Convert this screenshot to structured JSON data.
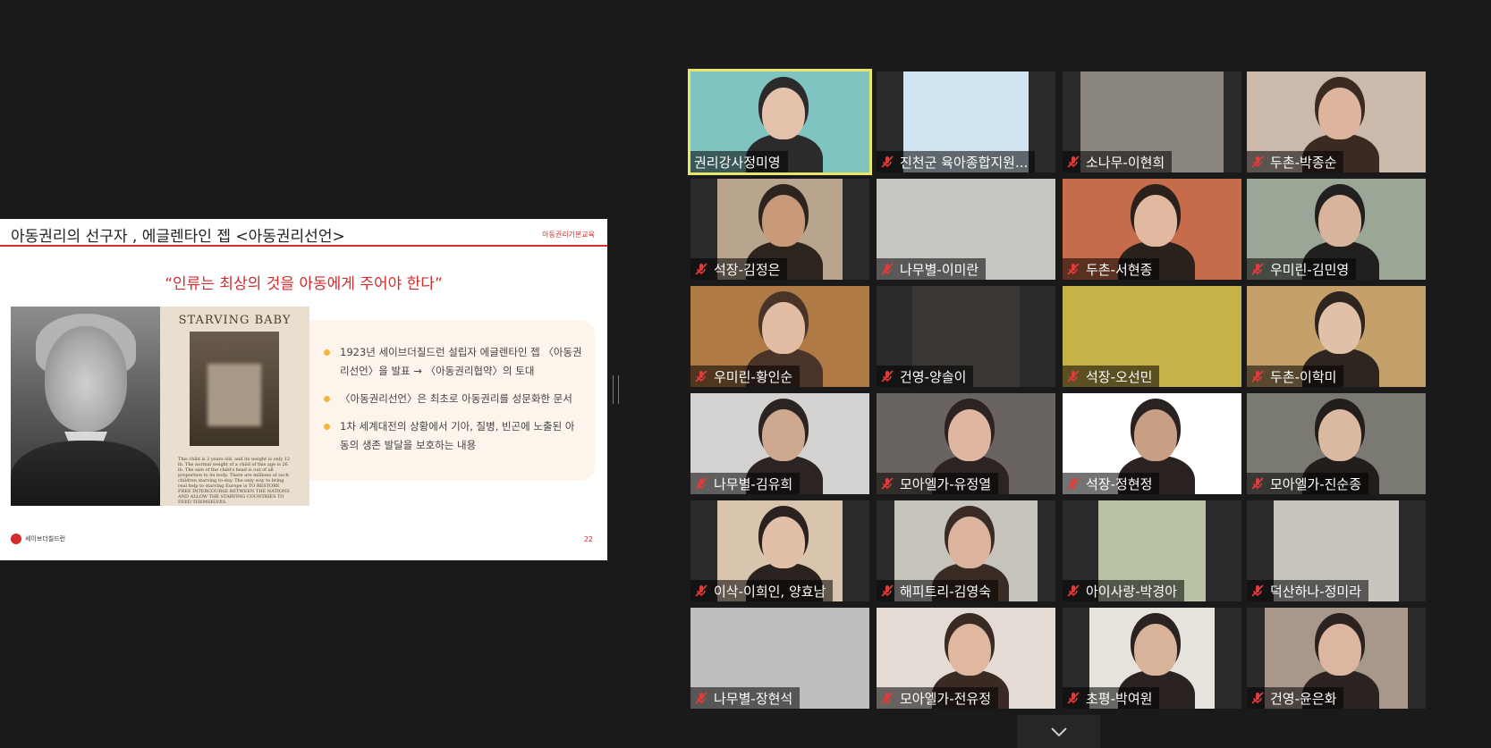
{
  "slide": {
    "title": "아동권리의 선구자 , 에글렌타인 젭 <아동권리선언>",
    "tag": "아동권리기본교육",
    "quote": "“인류는 최상의 것을 아동에게 주어야 한다”",
    "poster_title": "STARVING BABY",
    "poster_text": "This child is 2 years old, and its weight is only 12 lb. The normal weight of a child of this age is 26 lb. The size of the child's head is out of all proportion to its body. There are millions of such children starving to-day. The only way to bring real help to starving Europe is TO RESTORE FREE INTERCOURSE BETWEEN THE NATIONS AND ALLOW THE STARVING COUNTRIES TO FEED THEMSELVES.",
    "bullets": [
      "1923년 세이브더칠드런 설립자 에글렌타인 젭 〈아동권리선언〉을 발표 → 〈아동권리협약〉의 토대",
      "〈아동권리선언〉은 최초로 아동권리를 성문화한 문서",
      "1차 세계대전의 상황에서 기아, 질병, 빈곤에 노출된 아동의 생존 발달을 보호하는 내용"
    ],
    "logo_text": "세이브더칠드런",
    "page_number": "22"
  },
  "gallery": {
    "participants": [
      {
        "name": "권리강사정미영",
        "muted": false,
        "active": true,
        "bg": "#7fc4c0",
        "person": "#2b2b2b",
        "skin": "#e5c2ac"
      },
      {
        "name": "진천군 육아종합지원...",
        "muted": true,
        "active": false,
        "bg": "#cfe4f0",
        "person": "",
        "skin": ""
      },
      {
        "name": "소나무-이현희",
        "muted": true,
        "active": false,
        "bg": "#8c8680",
        "person": "",
        "skin": ""
      },
      {
        "name": "두촌-박종순",
        "muted": true,
        "active": false,
        "bg": "#cbb9ac",
        "person": "#3b2a22",
        "skin": "#dcb59c"
      },
      {
        "name": "석장-김정은",
        "muted": true,
        "active": false,
        "bg": "#b9a48e",
        "person": "#2d2420",
        "skin": "#c99a7a"
      },
      {
        "name": "나무별-이미란",
        "muted": true,
        "active": false,
        "bg": "#c8c6c2",
        "person": "",
        "skin": ""
      },
      {
        "name": "두촌-서현종",
        "muted": true,
        "active": false,
        "bg": "#c76c4a",
        "person": "#2a201c",
        "skin": "#e0b9a0"
      },
      {
        "name": "우미린-김민영",
        "muted": true,
        "active": false,
        "bg": "#9aa696",
        "person": "#22201e",
        "skin": "#d8b49c"
      },
      {
        "name": "우미린-황인순",
        "muted": true,
        "active": false,
        "bg": "#b07a46",
        "person": "#4a3428",
        "skin": "#e2bda4"
      },
      {
        "name": "건영-양솔이",
        "muted": true,
        "active": false,
        "bg": "#3a3634",
        "person": "",
        "skin": ""
      },
      {
        "name": "석장-오선민",
        "muted": true,
        "active": false,
        "bg": "#c7b24a",
        "person": "",
        "skin": ""
      },
      {
        "name": "두촌-이학미",
        "muted": true,
        "active": false,
        "bg": "#c6a06a",
        "person": "#2f2520",
        "skin": "#e0c0a6"
      },
      {
        "name": "나무별-김유희",
        "muted": true,
        "active": false,
        "bg": "#d4d2d0",
        "person": "#2b2422",
        "skin": "#cfa890"
      },
      {
        "name": "모아엘가-유정열",
        "muted": true,
        "active": false,
        "bg": "#6a6460",
        "person": "#2c2322",
        "skin": "#deb6a2"
      },
      {
        "name": "석장-정현정",
        "muted": true,
        "active": false,
        "bg": "#ffffff",
        "person": "#2a2220",
        "skin": "#c89e84"
      },
      {
        "name": "모아엘가-진순종",
        "muted": true,
        "active": false,
        "bg": "#7a7a72",
        "person": "#231e1c",
        "skin": "#dab8a2"
      },
      {
        "name": "이삭-이희인, 양효남",
        "muted": true,
        "active": false,
        "bg": "#d9c4ae",
        "person": "#2a221e",
        "skin": "#e2c0a8"
      },
      {
        "name": "해피트리-김영숙",
        "muted": true,
        "active": false,
        "bg": "#c6c2bc",
        "person": "#3a2c24",
        "skin": "#dcb49e"
      },
      {
        "name": "아이사랑-박경아",
        "muted": true,
        "active": false,
        "bg": "#b8c2a4",
        "person": "",
        "skin": ""
      },
      {
        "name": "덕산하나-정미라",
        "muted": true,
        "active": false,
        "bg": "#c8c4be",
        "person": "",
        "skin": ""
      },
      {
        "name": "나무별-장현석",
        "muted": true,
        "active": false,
        "bg": "#c0bebc",
        "person": "",
        "skin": ""
      },
      {
        "name": "모아엘가-전유정",
        "muted": true,
        "active": false,
        "bg": "#e4dcd4",
        "person": "#3a2a24",
        "skin": "#e0b8a0"
      },
      {
        "name": "초평-박여원",
        "muted": true,
        "active": false,
        "bg": "#e6e2dc",
        "person": "#2a2220",
        "skin": "#d9b29a"
      },
      {
        "name": "건영-윤은화",
        "muted": true,
        "active": false,
        "bg": "#a8988c",
        "person": "#2c2220",
        "skin": "#dcb6a0"
      }
    ]
  }
}
